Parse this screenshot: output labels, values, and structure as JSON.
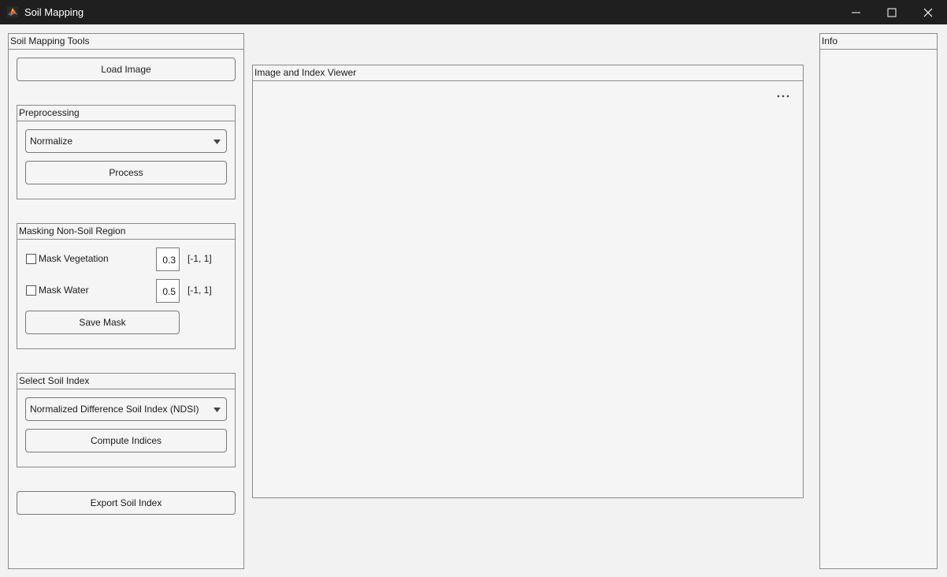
{
  "window": {
    "title": "Soil Mapping",
    "icons": {
      "app": "matlab-icon",
      "minimize": "minimize-icon",
      "maximize": "maximize-icon",
      "close": "close-icon"
    }
  },
  "tools_panel": {
    "title": "Soil Mapping Tools",
    "load_image_label": "Load Image",
    "preprocessing": {
      "title": "Preprocessing",
      "method_selected": "Normalize",
      "process_label": "Process"
    },
    "masking": {
      "title": "Masking Non-Soil Region",
      "vegetation": {
        "label": "Mask Vegetation",
        "checked": false,
        "value": "0.3",
        "range": "[-1, 1]"
      },
      "water": {
        "label": "Mask Water",
        "checked": false,
        "value": "0.5",
        "range": "[-1, 1]"
      },
      "save_mask_label": "Save Mask"
    },
    "soil_index": {
      "title": "Select Soil Index",
      "index_selected": "Normalized Difference Soil Index (NDSI)",
      "compute_label": "Compute Indices"
    },
    "export_label": "Export Soil Index"
  },
  "viewer_panel": {
    "title": "Image and Index Viewer",
    "toolbar_icon": "more-options-icon"
  },
  "info_panel": {
    "title": "Info"
  },
  "colors": {
    "titlebar": "#1f1f1f",
    "background": "#f2f2f2",
    "panel_border": "#8a8a8a"
  }
}
